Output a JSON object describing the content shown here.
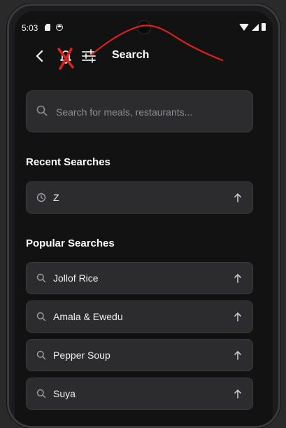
{
  "status_bar": {
    "time": "5:03"
  },
  "header": {
    "title": "Search"
  },
  "search": {
    "placeholder": "Search for meals, restaurants..."
  },
  "recent": {
    "title": "Recent Searches",
    "items": [
      {
        "label": "Z"
      }
    ]
  },
  "popular": {
    "title": "Popular Searches",
    "items": [
      {
        "label": "Jollof Rice"
      },
      {
        "label": "Amala & Ewedu"
      },
      {
        "label": "Pepper Soup"
      },
      {
        "label": "Suya"
      }
    ]
  },
  "colors": {
    "background": "#121212",
    "card": "#2c2c2e",
    "annotation": "#e0201c"
  }
}
